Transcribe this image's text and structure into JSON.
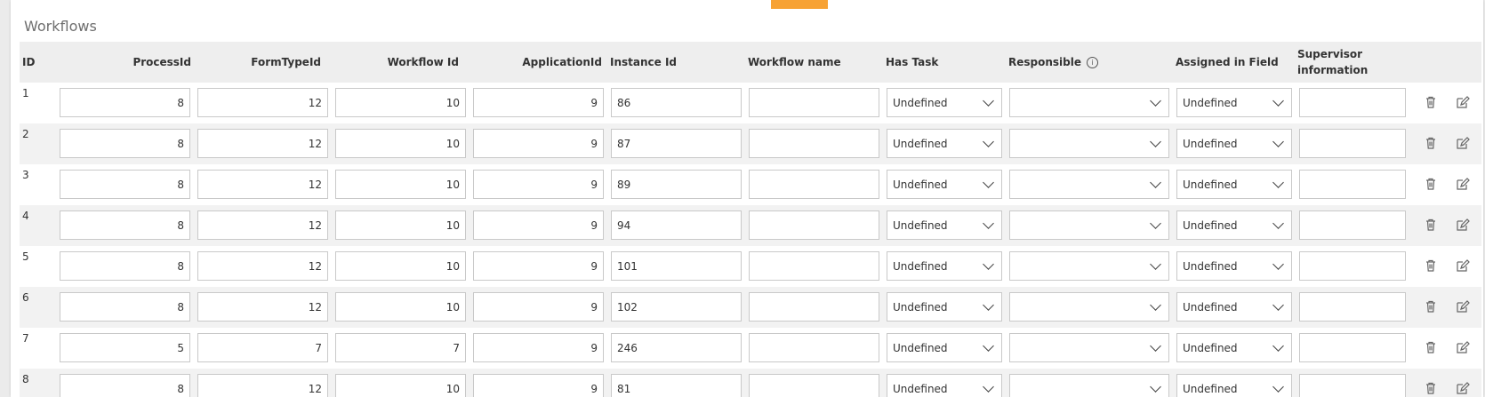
{
  "panel": {
    "title": "Workflows"
  },
  "columns": {
    "id": "ID",
    "process_id": "ProcessId",
    "form_type_id": "FormTypeId",
    "workflow_id": "Workflow Id",
    "application_id": "ApplicationId",
    "instance_id": "Instance Id",
    "workflow_name": "Workflow name",
    "has_task": "Has Task",
    "responsible": "Responsible",
    "assigned_in_field": "Assigned in Field",
    "supervisor_information": "Supervisor information"
  },
  "icons": {
    "responsible_info": "info-icon",
    "delete": "trash-icon",
    "edit": "edit-icon"
  },
  "colors": {
    "accent": "#f7a234",
    "header_bg": "#eeeeee",
    "alt_row_bg": "#f2f2f2"
  },
  "rows": [
    {
      "id": "1",
      "process_id": "8",
      "form_type_id": "12",
      "workflow_id": "10",
      "application_id": "9",
      "instance_id": "86",
      "workflow_name": "",
      "has_task": "Undefined",
      "responsible": "",
      "assigned_in_field": "Undefined",
      "supervisor_information": ""
    },
    {
      "id": "2",
      "process_id": "8",
      "form_type_id": "12",
      "workflow_id": "10",
      "application_id": "9",
      "instance_id": "87",
      "workflow_name": "",
      "has_task": "Undefined",
      "responsible": "",
      "assigned_in_field": "Undefined",
      "supervisor_information": ""
    },
    {
      "id": "3",
      "process_id": "8",
      "form_type_id": "12",
      "workflow_id": "10",
      "application_id": "9",
      "instance_id": "89",
      "workflow_name": "",
      "has_task": "Undefined",
      "responsible": "",
      "assigned_in_field": "Undefined",
      "supervisor_information": ""
    },
    {
      "id": "4",
      "process_id": "8",
      "form_type_id": "12",
      "workflow_id": "10",
      "application_id": "9",
      "instance_id": "94",
      "workflow_name": "",
      "has_task": "Undefined",
      "responsible": "",
      "assigned_in_field": "Undefined",
      "supervisor_information": ""
    },
    {
      "id": "5",
      "process_id": "8",
      "form_type_id": "12",
      "workflow_id": "10",
      "application_id": "9",
      "instance_id": "101",
      "workflow_name": "",
      "has_task": "Undefined",
      "responsible": "",
      "assigned_in_field": "Undefined",
      "supervisor_information": ""
    },
    {
      "id": "6",
      "process_id": "8",
      "form_type_id": "12",
      "workflow_id": "10",
      "application_id": "9",
      "instance_id": "102",
      "workflow_name": "",
      "has_task": "Undefined",
      "responsible": "",
      "assigned_in_field": "Undefined",
      "supervisor_information": ""
    },
    {
      "id": "7",
      "process_id": "5",
      "form_type_id": "7",
      "workflow_id": "7",
      "application_id": "9",
      "instance_id": "246",
      "workflow_name": "",
      "has_task": "Undefined",
      "responsible": "",
      "assigned_in_field": "Undefined",
      "supervisor_information": ""
    },
    {
      "id": "8",
      "process_id": "8",
      "form_type_id": "12",
      "workflow_id": "10",
      "application_id": "9",
      "instance_id": "81",
      "workflow_name": "",
      "has_task": "Undefined",
      "responsible": "",
      "assigned_in_field": "Undefined",
      "supervisor_information": ""
    }
  ]
}
